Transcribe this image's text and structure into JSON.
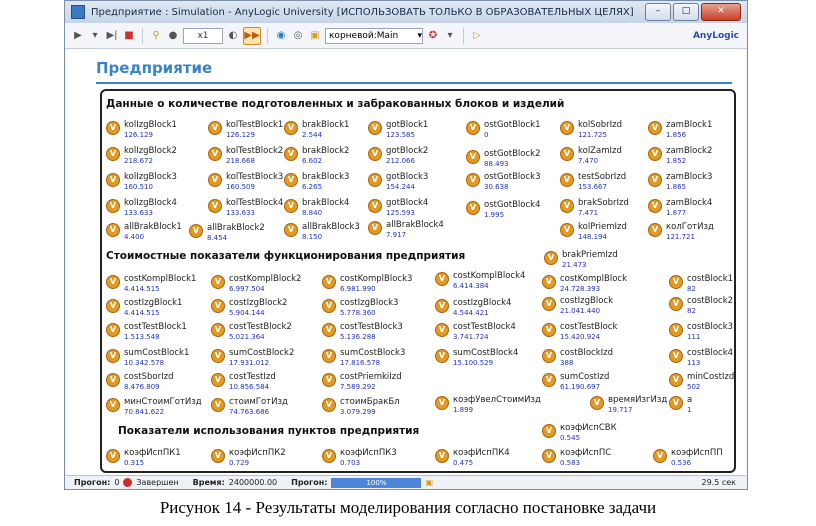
{
  "window": {
    "title": "Предприятие : Simulation - AnyLogic University  [ИСПОЛЬЗОВАТЬ ТОЛЬКО В ОБРАЗОВАТЕЛЬНЫХ ЦЕЛЯХ]",
    "buttons": {
      "minimize": "–",
      "maximize": "□",
      "close": "✕"
    }
  },
  "toolbar": {
    "speed": "x1",
    "root_select": "корневой:Main",
    "logo": "AnyLogic"
  },
  "page": {
    "heading": "Предприятие"
  },
  "sections": {
    "s1": "Данные о количестве подготовленных и забракованных блоков и изделий",
    "s2": "Стоимостные показатели функционирования предприятия",
    "s3": "Показатели использования пунктов предприятия"
  },
  "variables": [
    {
      "name": "kolIzgBlock1",
      "value": "126.129"
    },
    {
      "name": "kolTestBlock1",
      "value": "126.129"
    },
    {
      "name": "brakBlock1",
      "value": "2.544"
    },
    {
      "name": "gotBlock1",
      "value": "123.585"
    },
    {
      "name": "ostGotBlock1",
      "value": "0"
    },
    {
      "name": "kolSobrIzd",
      "value": "121.725"
    },
    {
      "name": "zamBlock1",
      "value": "1.856"
    },
    {
      "name": "kolIzgBlock2",
      "value": "218.672"
    },
    {
      "name": "kolTestBlock2",
      "value": "218.668"
    },
    {
      "name": "brakBlock2",
      "value": "6.602"
    },
    {
      "name": "gotBlock2",
      "value": "212.066"
    },
    {
      "name": "ostGotBlock2",
      "value": "88.493"
    },
    {
      "name": "kolZamIzd",
      "value": "7.470"
    },
    {
      "name": "zamBlock2",
      "value": "1.852"
    },
    {
      "name": "kolIzgBlock3",
      "value": "160.510"
    },
    {
      "name": "kolTestBlock3",
      "value": "160.509"
    },
    {
      "name": "brakBlock3",
      "value": "6.265"
    },
    {
      "name": "gotBlock3",
      "value": "154.244"
    },
    {
      "name": "ostGotBlock3",
      "value": "30.638"
    },
    {
      "name": "testSobrIzd",
      "value": "153.667"
    },
    {
      "name": "zamBlock3",
      "value": "1.865"
    },
    {
      "name": "kolIzgBlock4",
      "value": "133.633"
    },
    {
      "name": "kolTestBlock4",
      "value": "133.633"
    },
    {
      "name": "brakBlock4",
      "value": "8.840"
    },
    {
      "name": "gotBlock4",
      "value": "125.593"
    },
    {
      "name": "ostGotBlock4",
      "value": "1.995"
    },
    {
      "name": "brakSobrIzd",
      "value": "7.471"
    },
    {
      "name": "zamBlock4",
      "value": "1.877"
    },
    {
      "name": "allBrakBlock1",
      "value": "4.400"
    },
    {
      "name": "allBrakBlock2",
      "value": "8.454"
    },
    {
      "name": "allBrakBlock3",
      "value": "8.150"
    },
    {
      "name": "allBrakBlock4",
      "value": "7.917"
    },
    {
      "name": "kolPriemIzd",
      "value": "148.194"
    },
    {
      "name": "колГотИзд",
      "value": "121.721"
    },
    {
      "name": "brakPriemIzd",
      "value": "21.473"
    },
    {
      "name": "costKomplBlock1",
      "value": "4.414.515"
    },
    {
      "name": "costKomplBlock2",
      "value": "6.997.504"
    },
    {
      "name": "costKomplBlock3",
      "value": "6.981.990"
    },
    {
      "name": "costKomplBlock4",
      "value": "6.414.384"
    },
    {
      "name": "costKomplBlock",
      "value": "24.728.393"
    },
    {
      "name": "costBlock1",
      "value": "82"
    },
    {
      "name": "costIzgBlock1",
      "value": "4.414.515"
    },
    {
      "name": "costIzgBlock2",
      "value": "5.904.144"
    },
    {
      "name": "costIzgBlock3",
      "value": "5.778.360"
    },
    {
      "name": "costIzgBlock4",
      "value": "4.544.421"
    },
    {
      "name": "costIzgBlock",
      "value": "21.041.440"
    },
    {
      "name": "costBlock2",
      "value": "82"
    },
    {
      "name": "costTestBlock1",
      "value": "1.513.548"
    },
    {
      "name": "costTestBlock2",
      "value": "5.021.364"
    },
    {
      "name": "costTestBlock3",
      "value": "5.136.288"
    },
    {
      "name": "costTestBlock4",
      "value": "3.741.724"
    },
    {
      "name": "costTestBlock",
      "value": "15.420.924"
    },
    {
      "name": "costBlock3",
      "value": "111"
    },
    {
      "name": "sumCostBlock1",
      "value": "10.342.578"
    },
    {
      "name": "sumCostBlock2",
      "value": "17.931.012"
    },
    {
      "name": "sumCostBlock3",
      "value": "17.816.578"
    },
    {
      "name": "sumCostBlock4",
      "value": "15.100.529"
    },
    {
      "name": "costBlockIzd",
      "value": "388"
    },
    {
      "name": "costBlock4",
      "value": "113"
    },
    {
      "name": "costSborIzd",
      "value": "8.476.809"
    },
    {
      "name": "costTestIzd",
      "value": "10.856.584"
    },
    {
      "name": "costPriemkiIzd",
      "value": "7.589.292"
    },
    {
      "name": "sumCostIzd",
      "value": "61.190.697"
    },
    {
      "name": "minCostIzd",
      "value": "502"
    },
    {
      "name": "минСтоимГотИзд",
      "value": "70.841.622"
    },
    {
      "name": "стоимГотИзд",
      "value": "74.763.686"
    },
    {
      "name": "стоимБракБл",
      "value": "3.079.299"
    },
    {
      "name": "коэфУвелСтоимИзд",
      "value": "1.899"
    },
    {
      "name": "времяИзгИзд",
      "value": "19.717"
    },
    {
      "name": "a",
      "value": "1"
    },
    {
      "name": "коэфИспСВК",
      "value": "0.545"
    },
    {
      "name": "коэфИспПК1",
      "value": "0.315"
    },
    {
      "name": "коэфИспПК2",
      "value": "0.729"
    },
    {
      "name": "коэфИспПК3",
      "value": "0.703"
    },
    {
      "name": "коэфИспПК4",
      "value": "0.475"
    },
    {
      "name": "коэфИспПС",
      "value": "0.583"
    },
    {
      "name": "коэфИспПП",
      "value": "0.536"
    }
  ],
  "status": {
    "run_label": "Прогон:",
    "run_value": "0",
    "state": "Завершен",
    "time_label": "Время:",
    "time_value": "2400000.00",
    "progress_label": "Прогон:",
    "progress": "100%",
    "elapsed": "29.5 сек"
  },
  "caption": "Рисунок 14 - Результаты моделирования согласно постановке задачи"
}
